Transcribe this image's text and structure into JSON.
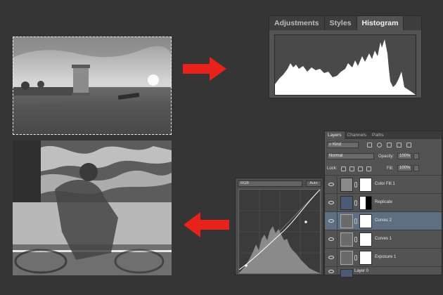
{
  "histogram_panel": {
    "tabs": [
      {
        "label": "Adjustments",
        "active": false
      },
      {
        "label": "Styles",
        "active": false
      },
      {
        "label": "Histogram",
        "active": true
      }
    ]
  },
  "layers_panel": {
    "tabs": [
      {
        "label": "Layers",
        "active": true
      },
      {
        "label": "Channels",
        "active": false
      },
      {
        "label": "Paths",
        "active": false
      }
    ],
    "filter_kind": "Kind",
    "blend_mode": "Normal",
    "opacity_label": "Opacity:",
    "opacity_value": "100%",
    "lock_label": "Lock:",
    "fill_label": "Fill:",
    "fill_value": "100%",
    "layers": [
      {
        "name": "Color Fill 1",
        "selected": false
      },
      {
        "name": "Replicate",
        "selected": false
      },
      {
        "name": "Curves 2",
        "selected": true
      },
      {
        "name": "Curves 1",
        "selected": false
      },
      {
        "name": "Exposure 1",
        "selected": false
      },
      {
        "name": "Layer 0",
        "selected": false
      }
    ]
  },
  "curves_panel": {
    "channel": "RGB",
    "auto_label": "Auto"
  },
  "colors": {
    "arrow": "#e8221b",
    "canvas": "#353535",
    "selected_layer": "#5f6f82"
  }
}
